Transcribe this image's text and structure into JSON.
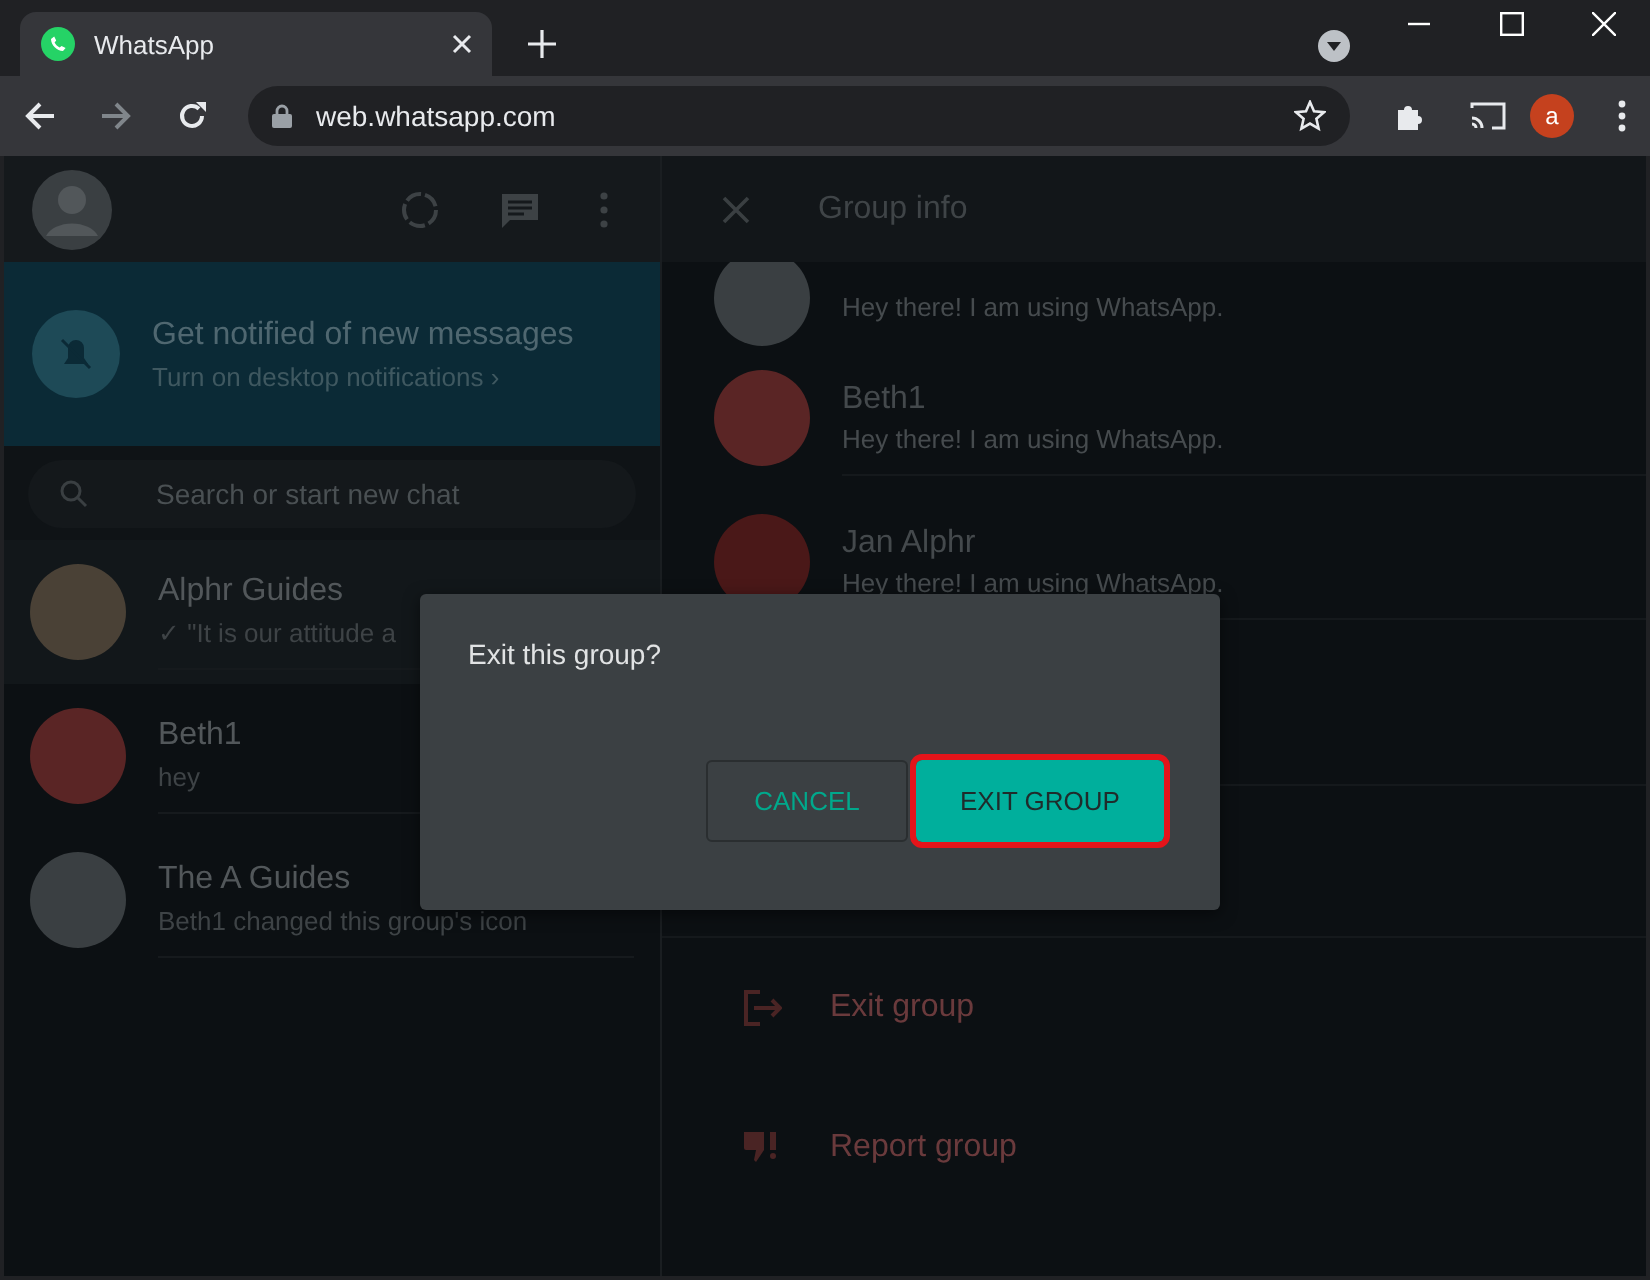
{
  "browser": {
    "tab": {
      "title": "WhatsApp"
    },
    "address": "web.whatsapp.com",
    "profile": "a"
  },
  "sidebar": {
    "notice": {
      "title": "Get notified of new messages",
      "subtitle": "Turn on desktop notifications ›"
    },
    "search": {
      "placeholder": "Search or start new chat"
    },
    "chats": [
      {
        "name": "Alphr Guides",
        "preview": "✓ \"It is our attitude a"
      },
      {
        "name": "Beth1",
        "preview": "hey"
      },
      {
        "name": "The A Guides",
        "preview": "Beth1 changed this group's icon"
      }
    ]
  },
  "group_info": {
    "title": "Group info",
    "members": [
      {
        "status": "Hey there! I am using WhatsApp."
      },
      {
        "name": "Beth1",
        "status": "Hey there! I am using WhatsApp."
      },
      {
        "name": "Jan Alphr",
        "status": "Hey there! I am using WhatsApp."
      }
    ],
    "actions": [
      {
        "kind": "exit",
        "label": "Exit group"
      },
      {
        "kind": "report",
        "label": "Report group"
      }
    ]
  },
  "dialog": {
    "message": "Exit this group?",
    "buttons": [
      {
        "kind": "cancel",
        "label": "CANCEL",
        "highlighted": false
      },
      {
        "kind": "confirm",
        "label": "EXIT GROUP",
        "highlighted": true
      }
    ]
  }
}
